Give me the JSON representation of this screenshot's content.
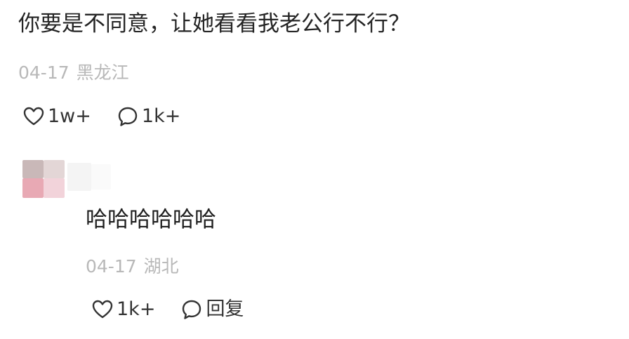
{
  "top_comment": {
    "text": "你要是不同意，让她看看我老公行不行？",
    "date": "04-17",
    "location": "黑龙江",
    "likes": "1w+",
    "comments": "1k+"
  },
  "reply": {
    "text": "哈哈哈哈哈哈",
    "date": "04-17",
    "location": "湖北",
    "likes": "1k+",
    "reply_label": "回复"
  },
  "icons": {
    "like": "heart-outline-icon",
    "comment": "speech-bubble-outline-icon"
  },
  "colors": {
    "text_primary": "#242424",
    "text_meta": "#b8b8b8",
    "icon": "#333333",
    "background": "#ffffff"
  }
}
